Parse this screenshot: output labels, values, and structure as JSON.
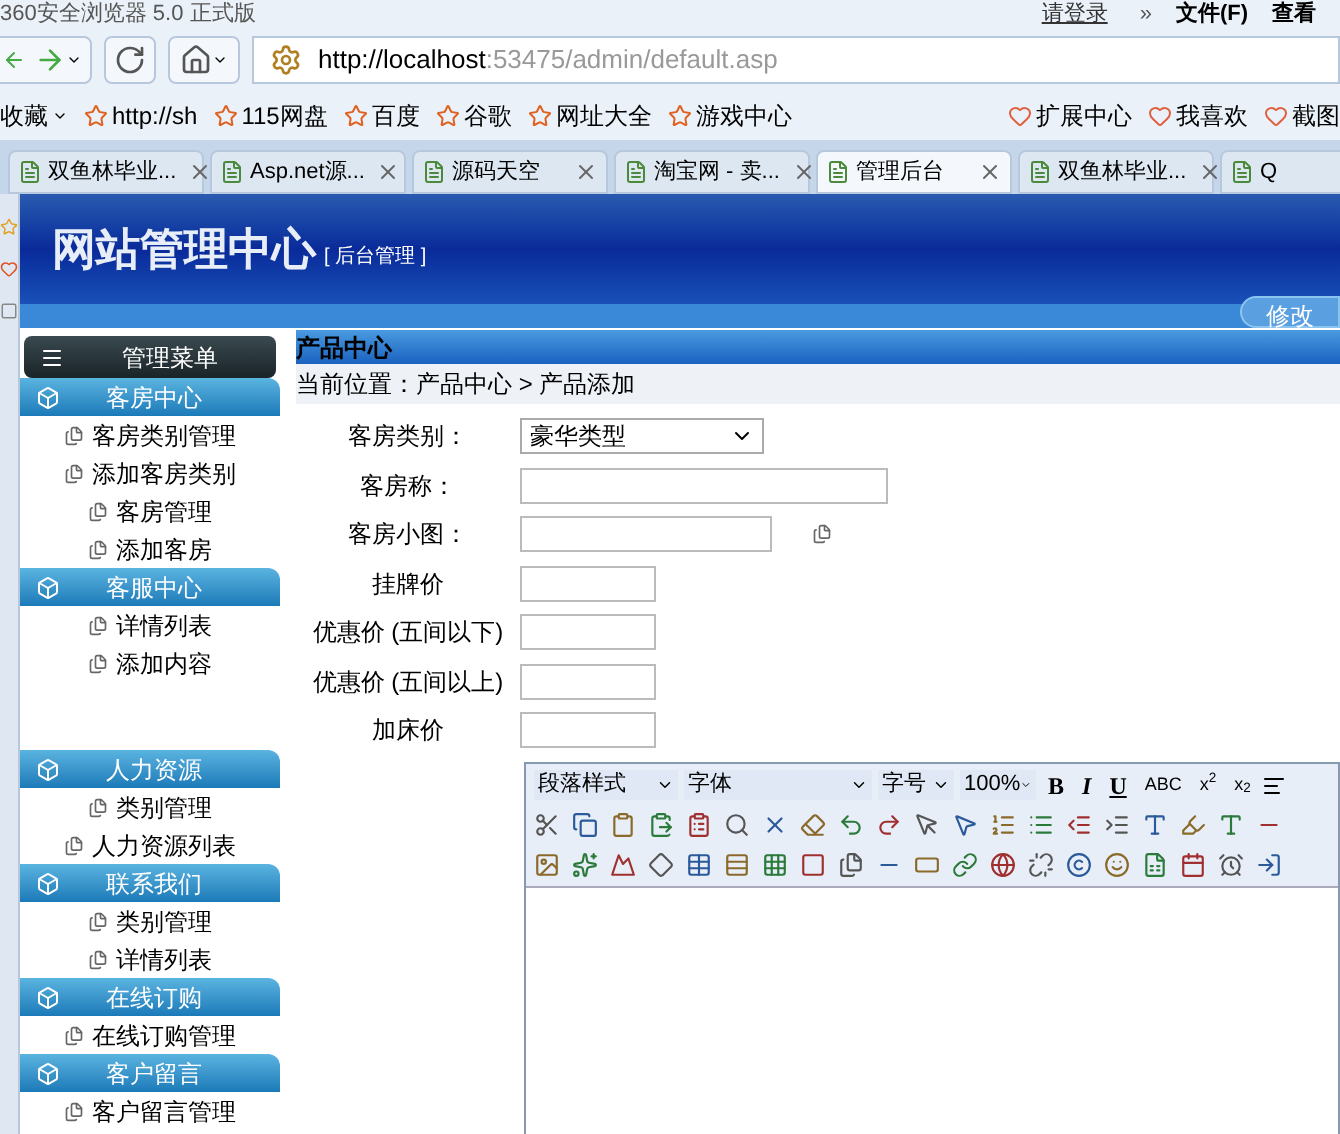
{
  "browser": {
    "title": "360安全浏览器 5.0 正式版",
    "account": "请登录",
    "more": "»",
    "menus": [
      "文件(F)",
      "查看"
    ],
    "address_host": "http://localhost",
    "address_rest": ":53475/admin/default.asp",
    "bookmarks": [
      {
        "label": "收藏"
      },
      {
        "label": "http://sh"
      },
      {
        "label": "115网盘"
      },
      {
        "label": "百度"
      },
      {
        "label": "谷歌"
      },
      {
        "label": "网址大全"
      },
      {
        "label": "游戏中心"
      }
    ],
    "tools": [
      {
        "label": "扩展中心"
      },
      {
        "label": "我喜欢"
      },
      {
        "label": "截图"
      }
    ],
    "tabs": [
      {
        "label": "双鱼林毕业...",
        "selected": false
      },
      {
        "label": "Asp.net源...",
        "selected": false
      },
      {
        "label": "源码天空",
        "selected": false
      },
      {
        "label": "淘宝网 - 卖...",
        "selected": false
      },
      {
        "label": "管理后台",
        "selected": true
      },
      {
        "label": "双鱼林毕业...",
        "selected": false
      },
      {
        "label": "Q",
        "selected": false
      }
    ]
  },
  "header": {
    "title": "网站管理中心",
    "subtitle": "[ 后台管理 ]",
    "button": "修改"
  },
  "sidebar": {
    "title": "管理菜单",
    "sections": [
      {
        "title": "客房中心",
        "items": [
          "客房类别管理",
          "添加客房类别",
          "客房管理",
          "添加客房"
        ]
      },
      {
        "title": "客服中心",
        "items": [
          "详情列表",
          "添加内容"
        ]
      },
      {
        "title": "人力资源",
        "items": [
          "类别管理",
          "人力资源列表"
        ]
      },
      {
        "title": "联系我们",
        "items": [
          "类别管理",
          "详情列表"
        ]
      },
      {
        "title": "在线订购",
        "items": [
          "在线订购管理"
        ]
      },
      {
        "title": "客户留言",
        "items": [
          "客户留言管理"
        ]
      }
    ]
  },
  "content": {
    "panel_title": "产品中心",
    "breadcrumb": "当前位置：产品中心 > 产品添加",
    "fields": [
      {
        "label": "客房类别：",
        "kind": "select",
        "value": "豪华类型"
      },
      {
        "label": "客房称：",
        "kind": "text"
      },
      {
        "label": "客房小图：",
        "kind": "image"
      },
      {
        "label": "挂牌价",
        "kind": "price"
      },
      {
        "label": "优惠价 (五间以下)",
        "kind": "price"
      },
      {
        "label": "优惠价 (五间以上)",
        "kind": "price"
      },
      {
        "label": "加床价",
        "kind": "price"
      }
    ]
  },
  "editor": {
    "selects": [
      {
        "label": "段落样式",
        "kind": "wide"
      },
      {
        "label": "字体",
        "kind": "wider"
      },
      {
        "label": "字号",
        "kind": "narrow"
      },
      {
        "label": "100%",
        "kind": "narrow"
      }
    ],
    "formats": [
      "B",
      "I",
      "U",
      "ABC",
      "x$^{2}$",
      "x$_{2}$"
    ]
  }
}
